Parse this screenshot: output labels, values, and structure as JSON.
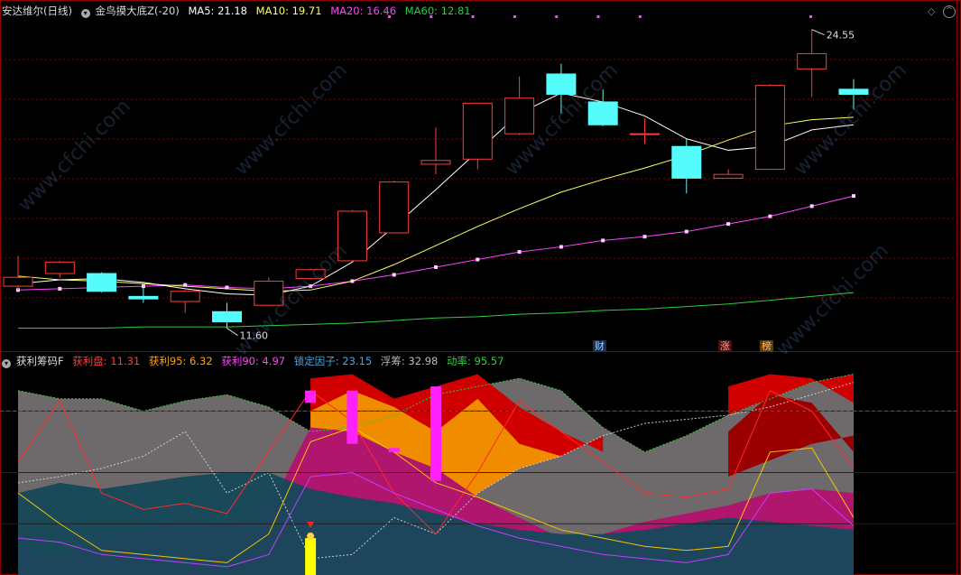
{
  "main_header": {
    "stock_name": "安达维尔",
    "period": "(日线)",
    "indicator_name": "金鸟摸大底Z(-20)",
    "ma5_label": "MA5: 21.18",
    "ma10_label": "MA10: 19.71",
    "ma20_label": "MA20: 16.46",
    "ma60_label": "MA60: 12.81"
  },
  "sub_header": {
    "indicator_name": "获利筹码F",
    "profit_disk": "获利盘: 11.31",
    "profit95": "获利95: 6.32",
    "profit90": "获利90: 4.97",
    "lock_factor": "锁定因子: 23.15",
    "float_chips": "浮筹: 32.98",
    "momentum": "动率: 95.57"
  },
  "price_labels": {
    "high": "24.55",
    "low": "11.60"
  },
  "badges": {
    "fin": "财",
    "up": "涨",
    "rank": "榜"
  },
  "watermark": "www.cfchi.com",
  "colors": {
    "up": "#ff3b3b",
    "down": "#54fcfc",
    "ma5": "#ffffff",
    "ma10": "#ffff66",
    "ma20": "#ff44ff",
    "ma60": "#2ecc40",
    "grid": "#8b0000"
  },
  "chart_data": {
    "type": "candlestick",
    "candles": [
      {
        "o": 14.9,
        "c": 15.6,
        "h": 17.3,
        "l": 14.6
      },
      {
        "o": 15.9,
        "c": 16.8,
        "h": 16.9,
        "l": 15.6
      },
      {
        "o": 15.9,
        "c": 14.5,
        "h": 16.0,
        "l": 14.4
      },
      {
        "o": 14.1,
        "c": 13.9,
        "h": 14.9,
        "l": 13.6
      },
      {
        "o": 13.7,
        "c": 14.5,
        "h": 14.6,
        "l": 12.8
      },
      {
        "o": 12.9,
        "c": 12.1,
        "h": 13.6,
        "l": 11.6
      },
      {
        "o": 13.4,
        "c": 15.3,
        "h": 15.6,
        "l": 13.4
      },
      {
        "o": 15.5,
        "c": 16.2,
        "h": 16.3,
        "l": 15.4
      },
      {
        "o": 16.9,
        "c": 20.8,
        "h": 20.9,
        "l": 16.9
      },
      {
        "o": 19.1,
        "c": 23.1,
        "h": 23.2,
        "l": 19.1
      },
      {
        "o": 24.5,
        "c": 24.8,
        "h": 27.4,
        "l": 23.7
      },
      {
        "o": 24.9,
        "c": 29.3,
        "h": 29.3,
        "l": 24.1
      },
      {
        "o": 26.9,
        "c": 29.7,
        "h": 31.4,
        "l": 26.8
      },
      {
        "o": 31.6,
        "c": 30.0,
        "h": 32.4,
        "l": 28.5
      },
      {
        "o": 29.4,
        "c": 27.6,
        "h": 30.4,
        "l": 27.5
      },
      {
        "o": 26.9,
        "c": 26.9,
        "h": 28.1,
        "l": 26.1
      },
      {
        "o": 25.9,
        "c": 23.4,
        "h": 26.5,
        "l": 22.2
      },
      {
        "o": 23.4,
        "c": 23.7,
        "h": 24.1,
        "l": 23.4
      },
      {
        "o": 24.1,
        "c": 30.7,
        "h": 30.8,
        "l": 24.1
      },
      {
        "o": 32.0,
        "c": 33.2,
        "h": 35.1,
        "l": 29.8
      },
      {
        "o": 30.4,
        "c": 30.0,
        "h": 31.2,
        "l": 28.8
      }
    ],
    "ma5": [
      15.1,
      15.4,
      15.5,
      15.2,
      14.7,
      14.3,
      14.2,
      14.9,
      16.8,
      19.6,
      22.5,
      25.5,
      28.5,
      30.1,
      29.4,
      28.3,
      26.5,
      25.6,
      25.9,
      27.2,
      27.6
    ],
    "ma10": [
      15.7,
      15.4,
      15.3,
      15.1,
      14.9,
      14.7,
      14.5,
      14.6,
      15.3,
      16.6,
      18.1,
      19.6,
      21.0,
      22.3,
      23.3,
      24.2,
      25.2,
      26.4,
      27.5,
      28.0,
      28.2
    ],
    "ma20": [
      14.6,
      14.7,
      14.8,
      14.9,
      15.0,
      14.8,
      14.7,
      14.9,
      15.3,
      15.8,
      16.4,
      17.0,
      17.6,
      18.0,
      18.5,
      18.8,
      19.2,
      19.8,
      20.4,
      21.2,
      22.0
    ],
    "ma60": [
      11.6,
      11.6,
      11.6,
      11.7,
      11.7,
      11.7,
      11.8,
      11.9,
      12.0,
      12.2,
      12.4,
      12.5,
      12.7,
      12.8,
      13.0,
      13.1,
      13.3,
      13.5,
      13.8,
      14.1,
      14.4
    ],
    "ylim": [
      11.0,
      36.0
    ],
    "sub_ylim": [
      0,
      100
    ],
    "sub": {
      "gray": [
        90,
        86,
        86,
        80,
        85,
        88,
        82,
        70,
        72,
        78,
        88,
        92,
        96,
        90,
        72,
        60,
        68,
        78,
        86,
        94,
        98
      ],
      "dashed": [
        45,
        48,
        52,
        58,
        70,
        40,
        50,
        8,
        10,
        28,
        20,
        40,
        52,
        58,
        68,
        74,
        76,
        78,
        82,
        88,
        94
      ],
      "pink": [
        12,
        8,
        16,
        22,
        28,
        24,
        32,
        72,
        70,
        60,
        52,
        38,
        28,
        18,
        20,
        26,
        30,
        34,
        40,
        42,
        40
      ],
      "red": [
        55,
        85,
        40,
        32,
        35,
        30,
        60,
        90,
        75,
        40,
        20,
        50,
        85,
        70,
        55,
        40,
        38,
        42,
        90,
        80,
        52
      ],
      "yellow": [
        40,
        25,
        12,
        10,
        8,
        6,
        20,
        65,
        72,
        60,
        45,
        38,
        30,
        22,
        18,
        14,
        12,
        14,
        60,
        62,
        28
      ],
      "magenta": [
        18,
        16,
        10,
        8,
        6,
        4,
        10,
        48,
        50,
        40,
        32,
        24,
        18,
        14,
        10,
        8,
        6,
        10,
        40,
        42,
        24
      ],
      "teal": [
        40,
        45,
        42,
        45,
        48,
        50,
        50,
        42,
        38,
        35,
        30,
        25,
        22,
        20,
        20,
        22,
        25,
        28,
        26,
        24,
        22
      ]
    }
  }
}
